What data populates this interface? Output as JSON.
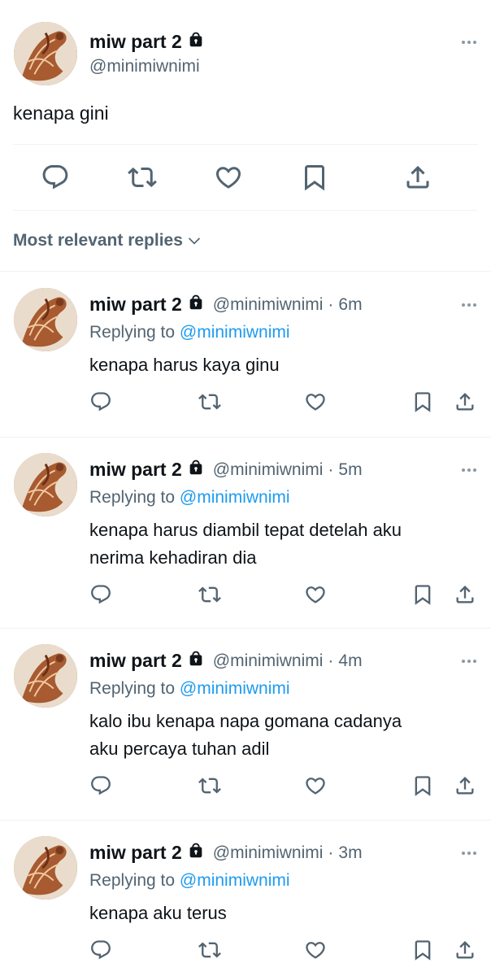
{
  "main_tweet": {
    "name": "miw part 2",
    "handle": "@minimiwnimi",
    "text": "kenapa gini",
    "avatar_icon": "avatar-image",
    "lock_icon": "lock-icon"
  },
  "actions": {
    "reply_icon": "reply-icon",
    "retweet_icon": "retweet-icon",
    "like_icon": "heart-icon",
    "bookmark_icon": "bookmark-icon",
    "share_icon": "share-icon"
  },
  "sort": {
    "label": "Most relevant replies"
  },
  "replies": [
    {
      "name": "miw part 2",
      "handle": "@minimiwnimi",
      "sep": "·",
      "time": "6m",
      "replying_prefix": "Replying to",
      "replying_to": "@minimiwnimi",
      "text_lines": [
        "kenapa harus kaya ginu"
      ]
    },
    {
      "name": "miw part 2",
      "handle": "@minimiwnimi",
      "sep": "·",
      "time": "5m",
      "replying_prefix": "Replying to",
      "replying_to": "@minimiwnimi",
      "text_lines": [
        "kenapa harus diambil tepat detelah aku",
        "nerima kehadiran dia"
      ]
    },
    {
      "name": "miw part 2",
      "handle": "@minimiwnimi",
      "sep": "·",
      "time": "4m",
      "replying_prefix": "Replying to",
      "replying_to": "@minimiwnimi",
      "text_lines": [
        "kalo ibu kenapa napa gomana cadanya",
        "aku percaya tuhan adil"
      ]
    },
    {
      "name": "miw part 2",
      "handle": "@minimiwnimi",
      "sep": "·",
      "time": "3m",
      "replying_prefix": "Replying to",
      "replying_to": "@minimiwnimi",
      "text_lines": [
        "kenapa aku terus"
      ]
    }
  ],
  "colors": {
    "text": "#0f1419",
    "secondary": "#536471",
    "link": "#1d9bf0",
    "divider": "#eff3f4"
  }
}
